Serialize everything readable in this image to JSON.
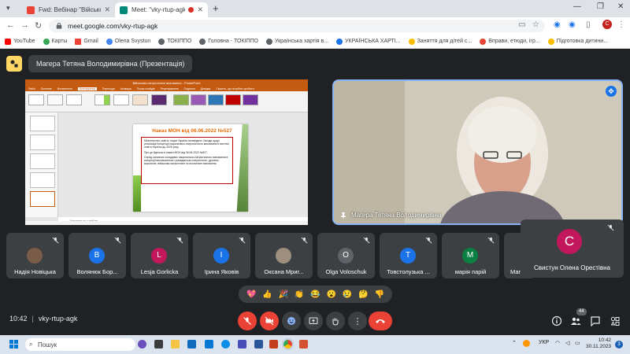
{
  "browser": {
    "tabs": [
      {
        "title": "Fwd: Вебінар \"Військово-патріо",
        "active": false
      },
      {
        "title": "Meet: \"vky-rtup-agk\"",
        "active": true
      }
    ],
    "url": "meet.google.com/vky-rtup-agk",
    "profile_initial": "C",
    "bookmarks": [
      "YouTube",
      "Карты",
      "Gmail",
      "Olena Svystun",
      "ТОКІППО",
      "Головна - ТОКІППО",
      "Українська хартія в...",
      "УКРАЇНСЬКА ХАРТІ...",
      "Заняття для дітей с...",
      "Вправи, етюди, ігр...",
      "Підготовка дитини..."
    ]
  },
  "meet": {
    "presentation_label": "Магера Тетяна Володимирівна (Презентація)",
    "slide": {
      "window_title": "Військово-патріотичне виховання - PowerPoint",
      "ribbon_tabs": [
        "Файл",
        "Основне",
        "Вставлення",
        "Конструктор",
        "Переходи",
        "Анімація",
        "Показ слайдів",
        "Рецензування",
        "Подання",
        "Довідка",
        "Скажіть, що потрібно зробити"
      ],
      "title": "Наказ МОН від 06.06.2022 №527",
      "bullets": [
        "Міністерство освіти і науки України затвердило Заходи щодо реалізації Концепції національно-патріотичного виховання в системі освіти України до 2025 року.",
        "Про це йдеться в наказі МОН від 06.06.2022 №527.",
        "Серед основних складових національно-патріотичного виховання в концепції визначаються громадянсько-патріотичне, духовно-моральне, військово-патріотичне та екологічне виховання."
      ],
      "notes_placeholder": "Нотатки до слайда"
    },
    "speaker_name": "Магера Тетяна Володимирівна",
    "participants": [
      {
        "name": "Надія Новіцька",
        "initial": "",
        "color": "#7a5c48"
      },
      {
        "name": "Волянюк Бор...",
        "initial": "В",
        "color": "#1a73e8"
      },
      {
        "name": "Lesja Gorlicka",
        "initial": "L",
        "color": "#c2185b"
      },
      {
        "name": "Ірина Яковів",
        "initial": "І",
        "color": "#1a73e8"
      },
      {
        "name": "Оксана Мриг...",
        "initial": "",
        "color": "#9e8f7c"
      },
      {
        "name": "Olga Voloschuk",
        "initial": "О",
        "color": "#5f6368"
      },
      {
        "name": "Товстолузька ...",
        "initial": "Т",
        "color": "#1a73e8"
      },
      {
        "name": "марія парій",
        "initial": "М",
        "color": "#0b8043"
      },
      {
        "name": "Маг",
        "initial": "",
        "color": "#3c4043"
      }
    ],
    "self_tile": {
      "name": "Свистун Олена Орестівна",
      "initial": "С"
    },
    "reactions": [
      "💖",
      "👍",
      "🎉",
      "👏",
      "😂",
      "😮",
      "😢",
      "🤔",
      "👎"
    ],
    "time": "10:42",
    "meeting_code": "vky-rtup-agk",
    "participant_count": "44",
    "colors": {
      "bg": "#202124",
      "tile": "#3c4043",
      "red": "#ea4335",
      "accent": "#8ab4f8"
    }
  },
  "taskbar": {
    "search_label": "Пошук",
    "language": "УКР",
    "time": "10:42",
    "date": "30.11.2023",
    "notifications": "3"
  }
}
